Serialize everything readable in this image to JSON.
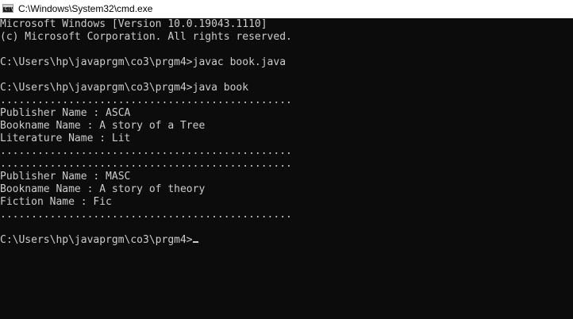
{
  "window": {
    "title": "C:\\Windows\\System32\\cmd.exe",
    "icon": "cmd-icon"
  },
  "console": {
    "lines": [
      "Microsoft Windows [Version 10.0.19043.1110]",
      "(c) Microsoft Corporation. All rights reserved.",
      "",
      "C:\\Users\\hp\\javaprgm\\co3\\prgm4>javac book.java",
      "",
      "C:\\Users\\hp\\javaprgm\\co3\\prgm4>java book",
      "...............................................",
      "Publisher Name : ASCA",
      "Bookname Name : A story of a Tree",
      "Literature Name : Lit",
      "...............................................",
      "...............................................",
      "Publisher Name : MASC",
      "Bookname Name : A story of theory",
      "Fiction Name : Fic",
      "...............................................",
      "",
      "C:\\Users\\hp\\javaprgm\\co3\\prgm4>"
    ]
  },
  "colors": {
    "background": "#0c0c0c",
    "text": "#cccccc",
    "titlebar": "#ffffff"
  }
}
